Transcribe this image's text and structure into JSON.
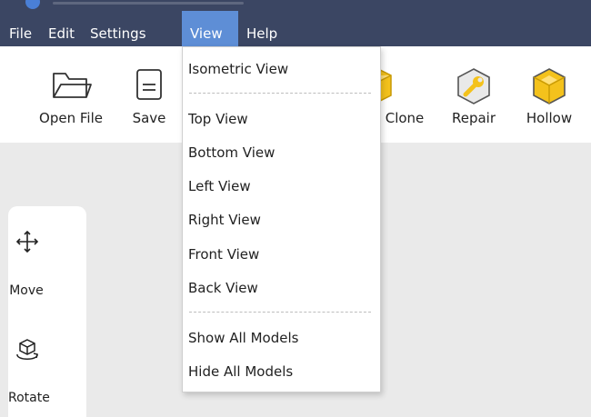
{
  "menubar": {
    "items": [
      "File",
      "Edit",
      "Settings",
      "View",
      "Help"
    ],
    "active": "View",
    "active_color": "#5e8ed6",
    "background": "#3b4663"
  },
  "toolbar": {
    "open_file": "Open File",
    "save": "Save",
    "clone": "Clone",
    "repair": "Repair",
    "hollow": "Hollow"
  },
  "view_menu": {
    "items": [
      "Isometric View",
      "Top View",
      "Bottom View",
      "Left View",
      "Right View",
      "Front View",
      "Back View",
      "Show All Models",
      "Hide All Models"
    ]
  },
  "side_tools": {
    "move": "Move",
    "rotate": "Rotate"
  },
  "icons": {
    "open_file": "folder-icon",
    "save": "save-icon",
    "clone": "clone-icon",
    "repair": "wrench-icon",
    "hollow": "hollow-cube-icon",
    "move": "move-arrows-icon",
    "rotate": "rotate-icon"
  },
  "accent_colors": {
    "yellow": "#f4c21c",
    "menu_highlight": "#5e8ed6"
  }
}
